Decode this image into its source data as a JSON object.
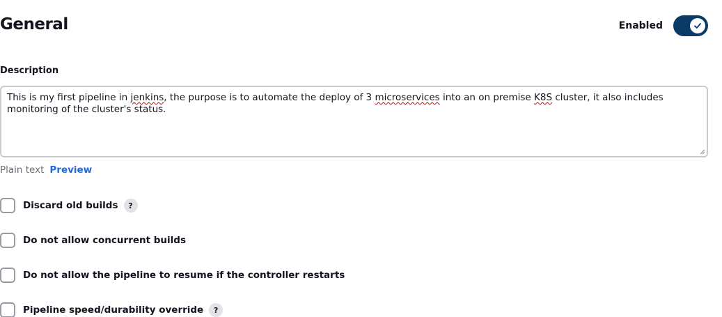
{
  "header": {
    "title": "General",
    "enabled_label": "Enabled",
    "enabled": true
  },
  "description": {
    "label": "Description",
    "segments": [
      {
        "text": "This is my first pipeline in ",
        "spell": false
      },
      {
        "text": "jenkins",
        "spell": true
      },
      {
        "text": ", the purpose is to automate the deploy of 3 ",
        "spell": false
      },
      {
        "text": "microservices",
        "spell": true
      },
      {
        "text": " into an on premise ",
        "spell": false
      },
      {
        "text": "K8S",
        "spell": true
      },
      {
        "text": " cluster, it also includes monitoring of the cluster's status.",
        "spell": false
      }
    ]
  },
  "format": {
    "plain_text": "Plain text",
    "preview": "Preview"
  },
  "options": [
    {
      "label": "Discard old builds",
      "help": "?",
      "checked": false
    },
    {
      "label": "Do not allow concurrent builds",
      "help": "",
      "checked": false
    },
    {
      "label": "Do not allow the pipeline to resume if the controller restarts",
      "help": "",
      "checked": false
    },
    {
      "label": "Pipeline speed/durability override",
      "help": "?",
      "checked": false
    }
  ],
  "colors": {
    "toggle_on": "#0c3a66",
    "link": "#1f6ae0",
    "spellcheck": "#d40000"
  }
}
